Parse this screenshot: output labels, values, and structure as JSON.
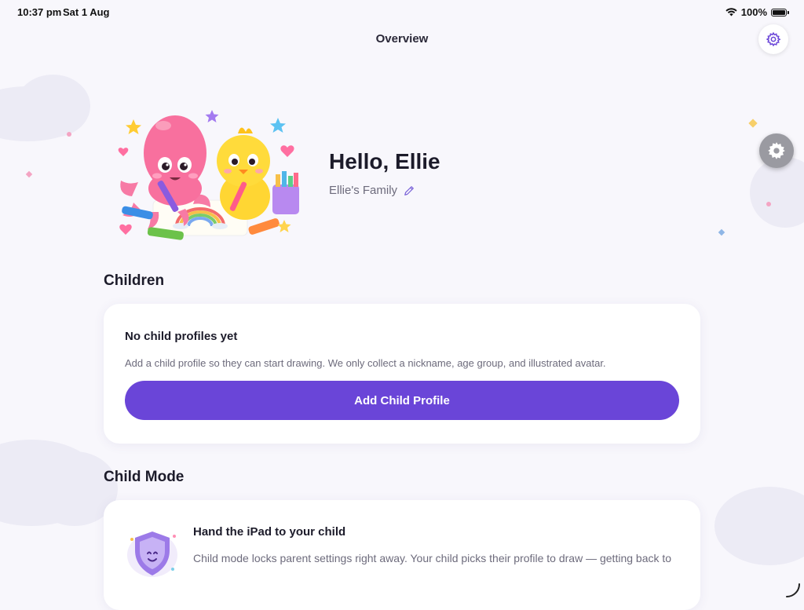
{
  "status_bar": {
    "time": "10:37 pm",
    "date": "Sat 1 Aug",
    "battery": "100%"
  },
  "nav": {
    "title": "Overview"
  },
  "profile": {
    "greeting": "Hello, Ellie",
    "family_name": "Ellie's Family"
  },
  "children_section": {
    "title": "Children",
    "empty_title": "No child profiles yet",
    "empty_description": "Add a child profile so they can start drawing. We only collect a nickname, age group, and illustrated avatar.",
    "add_button_label": "Add Child Profile"
  },
  "child_mode_section": {
    "title": "Child Mode",
    "card_title": "Hand the iPad to your child",
    "card_description": "Child mode locks parent settings right away. Your child picks their profile to draw — getting back to"
  },
  "colors": {
    "accent": "#6a45d8",
    "background": "#f8f7fc",
    "card": "#ffffff"
  },
  "icons": [
    "wifi-icon",
    "battery-icon",
    "settings-gear-icon",
    "edit-pencil-icon",
    "shield-icon"
  ]
}
